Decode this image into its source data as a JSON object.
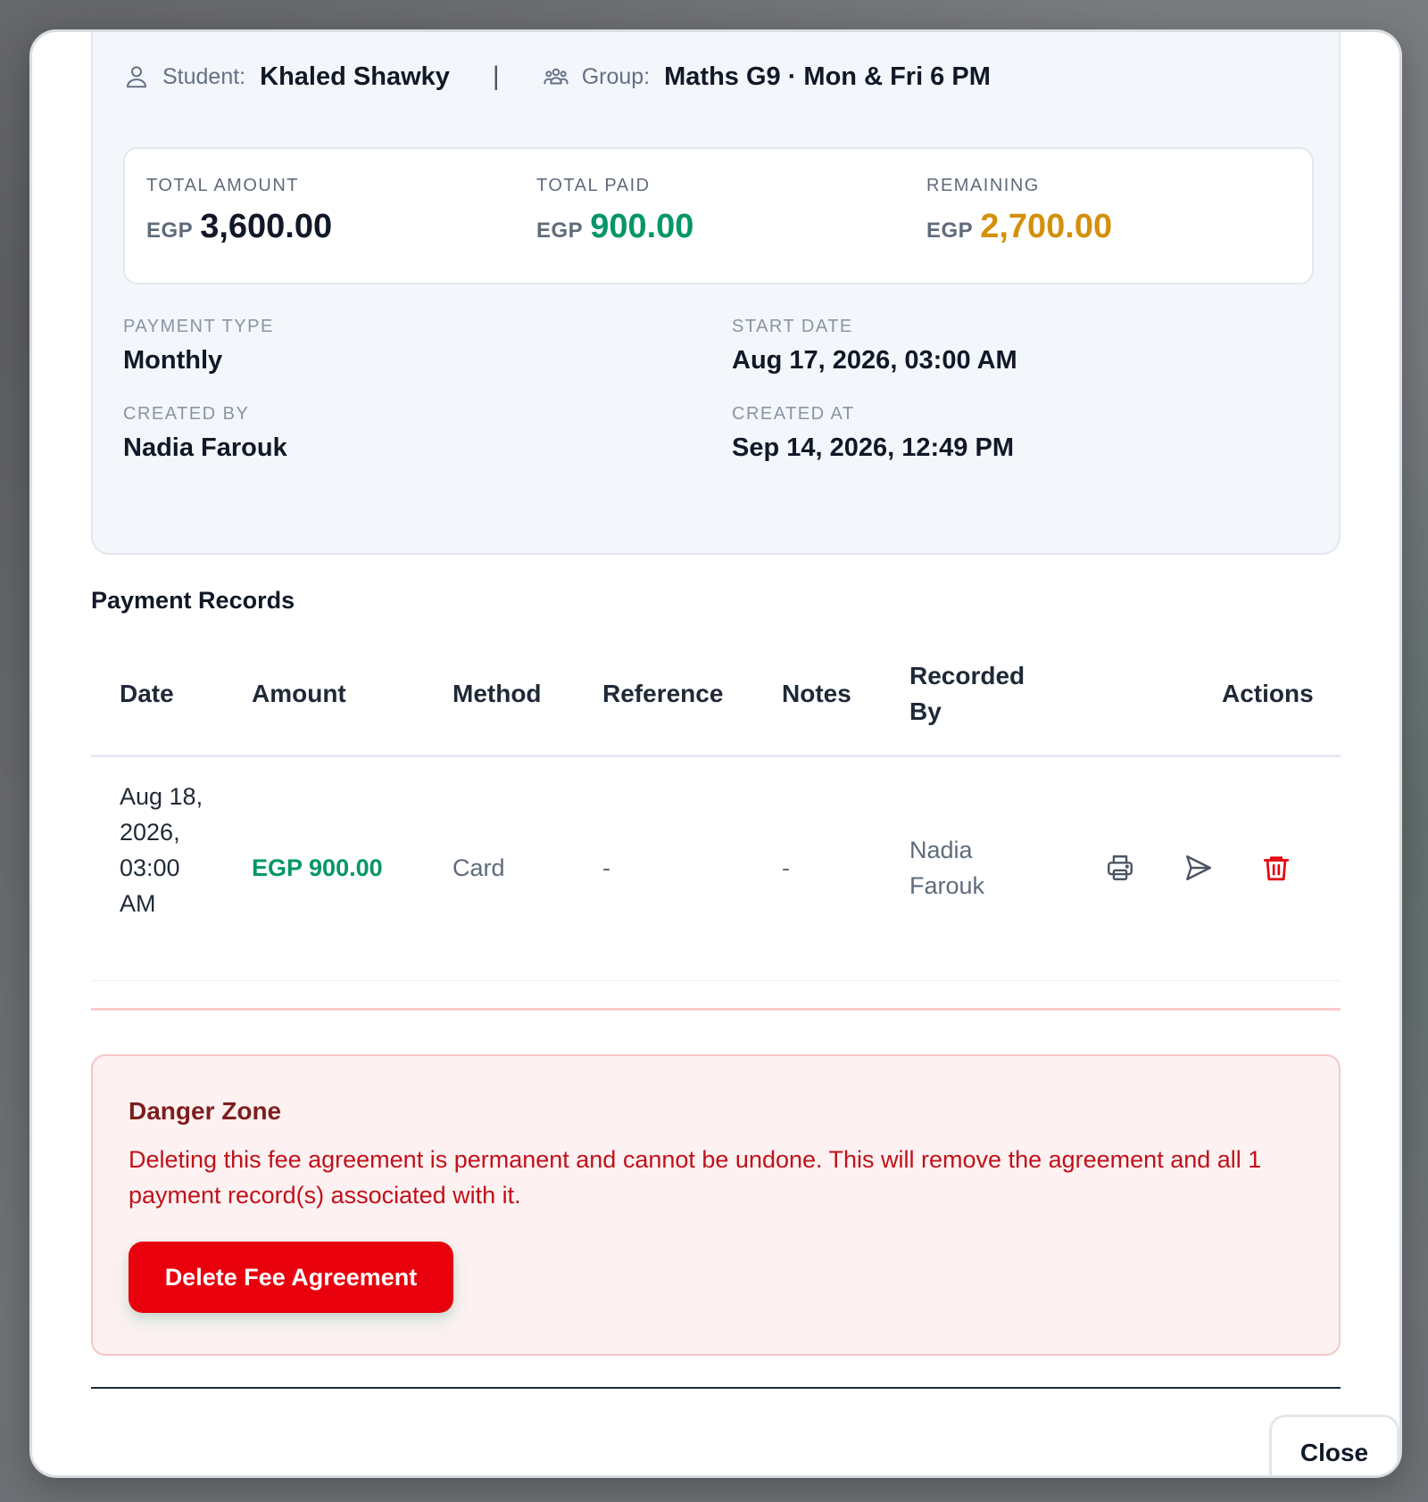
{
  "header": {
    "student_label": "Student:",
    "student_name": "Khaled Shawky",
    "separator": "|",
    "group_label": "Group:",
    "group_name": "Maths G9 · Mon & Fri 6 PM",
    "student_icon": "user-icon",
    "group_icon": "users-group-icon"
  },
  "totals": {
    "currency": "EGP",
    "total_amount_label": "TOTAL AMOUNT",
    "total_amount": "3,600.00",
    "total_paid_label": "TOTAL PAID",
    "total_paid": "900.00",
    "remaining_label": "REMAINING",
    "remaining": "2,700.00",
    "colors": {
      "paid": "#059669",
      "remaining": "#d4900c"
    }
  },
  "details": {
    "payment_type_label": "PAYMENT TYPE",
    "payment_type": "Monthly",
    "start_date_label": "START DATE",
    "start_date": "Aug 17, 2026, 03:00 AM",
    "created_by_label": "CREATED BY",
    "created_by": "Nadia Farouk",
    "created_at_label": "CREATED AT",
    "created_at": "Sep 14, 2026, 12:49 PM"
  },
  "payment_records": {
    "title": "Payment Records",
    "columns": {
      "date": "Date",
      "amount": "Amount",
      "method": "Method",
      "reference": "Reference",
      "notes": "Notes",
      "recorded_by_line1": "Recorded",
      "recorded_by_line2": "By",
      "actions": "Actions"
    },
    "rows": [
      {
        "date": "Aug 18, 2026, 03:00 AM",
        "amount": "EGP 900.00",
        "method": "Card",
        "reference": "-",
        "notes": "-",
        "recorded_by": "Nadia Farouk",
        "actions": [
          "printer-icon",
          "send-icon",
          "trash-icon"
        ]
      }
    ]
  },
  "danger_zone": {
    "title": "Danger Zone",
    "message": "Deleting this fee agreement is permanent and cannot be undone. This will remove the agreement and all 1 payment record(s) associated with it.",
    "delete_button": "Delete Fee Agreement",
    "accent": "#e8000c"
  },
  "footer": {
    "close_button": "Close"
  }
}
